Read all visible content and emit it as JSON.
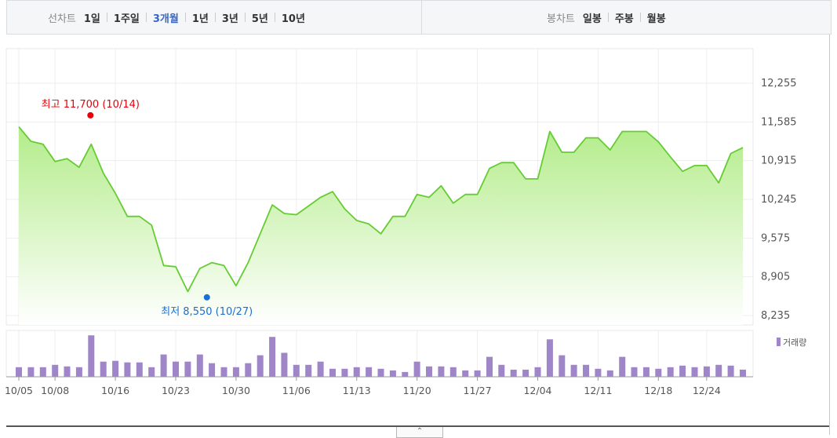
{
  "toolbar": {
    "line_chart_label": "선차트",
    "periods": [
      {
        "label": "1일",
        "active": false
      },
      {
        "label": "1주일",
        "active": false
      },
      {
        "label": "3개월",
        "active": true
      },
      {
        "label": "1년",
        "active": false
      },
      {
        "label": "3년",
        "active": false
      },
      {
        "label": "5년",
        "active": false
      },
      {
        "label": "10년",
        "active": false
      }
    ],
    "candle_chart_label": "봉차트",
    "candles": [
      {
        "label": "일봉"
      },
      {
        "label": "주봉"
      },
      {
        "label": "월봉"
      }
    ]
  },
  "colors": {
    "line": "#66cc33",
    "area_top": "#b3ec8a",
    "volume_bar": "#9e86c8",
    "high_marker": "#e8000b",
    "low_marker": "#1a6fd0",
    "active_period": "#3a66c4"
  },
  "collapse_icon": "chevron-up-icon",
  "chart_data": {
    "type": "area",
    "y_ticks": [
      "12,255",
      "11,585",
      "10,915",
      "10,245",
      "9,575",
      "8,905",
      "8,235"
    ],
    "ylim": [
      8235,
      12255
    ],
    "x_tick_labels": [
      "10/05",
      "10/08",
      "10/16",
      "10/23",
      "10/30",
      "11/06",
      "11/13",
      "11/20",
      "11/27",
      "12/04",
      "12/11",
      "12/18",
      "12/24"
    ],
    "x_tick_indices": [
      0,
      3,
      8,
      13,
      18,
      23,
      28,
      33,
      38,
      43,
      48,
      53,
      57
    ],
    "prices": [
      11500,
      11250,
      11200,
      10900,
      10950,
      10800,
      11200,
      10700,
      10350,
      9950,
      9950,
      9800,
      9100,
      9080,
      8650,
      9050,
      9150,
      9100,
      8750,
      9150,
      9650,
      10150,
      10000,
      9980,
      10130,
      10280,
      10380,
      10080,
      9880,
      9820,
      9650,
      9950,
      9950,
      10330,
      10280,
      10480,
      10180,
      10330,
      10330,
      10780,
      10880,
      10880,
      10600,
      10600,
      11420,
      11060,
      11060,
      11310,
      11310,
      11100,
      11420,
      11420,
      11420,
      11240,
      10980,
      10730,
      10830,
      10830,
      10530,
      11040,
      11140
    ],
    "volume_label": "거래량",
    "volumes": [
      12,
      12,
      12,
      15,
      13,
      12,
      52,
      19,
      20,
      18,
      18,
      12,
      28,
      19,
      19,
      28,
      17,
      12,
      12,
      17,
      27,
      50,
      30,
      15,
      15,
      19,
      10,
      10,
      12,
      12,
      10,
      8,
      6,
      19,
      13,
      13,
      12,
      8,
      8,
      25,
      15,
      9,
      9,
      12,
      47,
      27,
      15,
      15,
      10,
      8,
      25,
      12,
      12,
      10,
      12,
      14,
      12,
      13,
      15,
      14,
      9
    ],
    "high": {
      "label": "최고 11,700 (10/14)",
      "value": 11700,
      "index": 6
    },
    "low": {
      "label": "최저 8,550 (10/27)",
      "value": 8550,
      "index": 15
    },
    "legend": "거래량"
  }
}
